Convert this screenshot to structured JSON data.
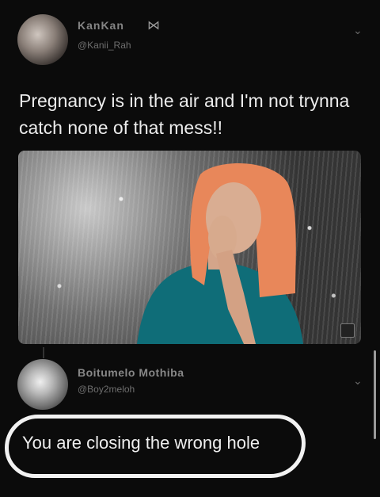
{
  "tweet": {
    "author_name": "KanKan",
    "author_handle": "@Kanii_Rah",
    "text": "Pregnancy is in the air and I'm not trynna catch none of that mess!!",
    "media_alt_icon": "image-icon"
  },
  "reply": {
    "author_name": "Boitumelo Mothiba",
    "author_handle": "@Boy2meloh",
    "text": "You are closing the wrong hole"
  },
  "icons": {
    "menu": "chevron-down-icon",
    "badge": "bow-icon"
  },
  "colors": {
    "background": "#0b0b0b",
    "text": "#ececec",
    "muted": "#6f6f6f",
    "highlight": "#f2f2f2"
  }
}
